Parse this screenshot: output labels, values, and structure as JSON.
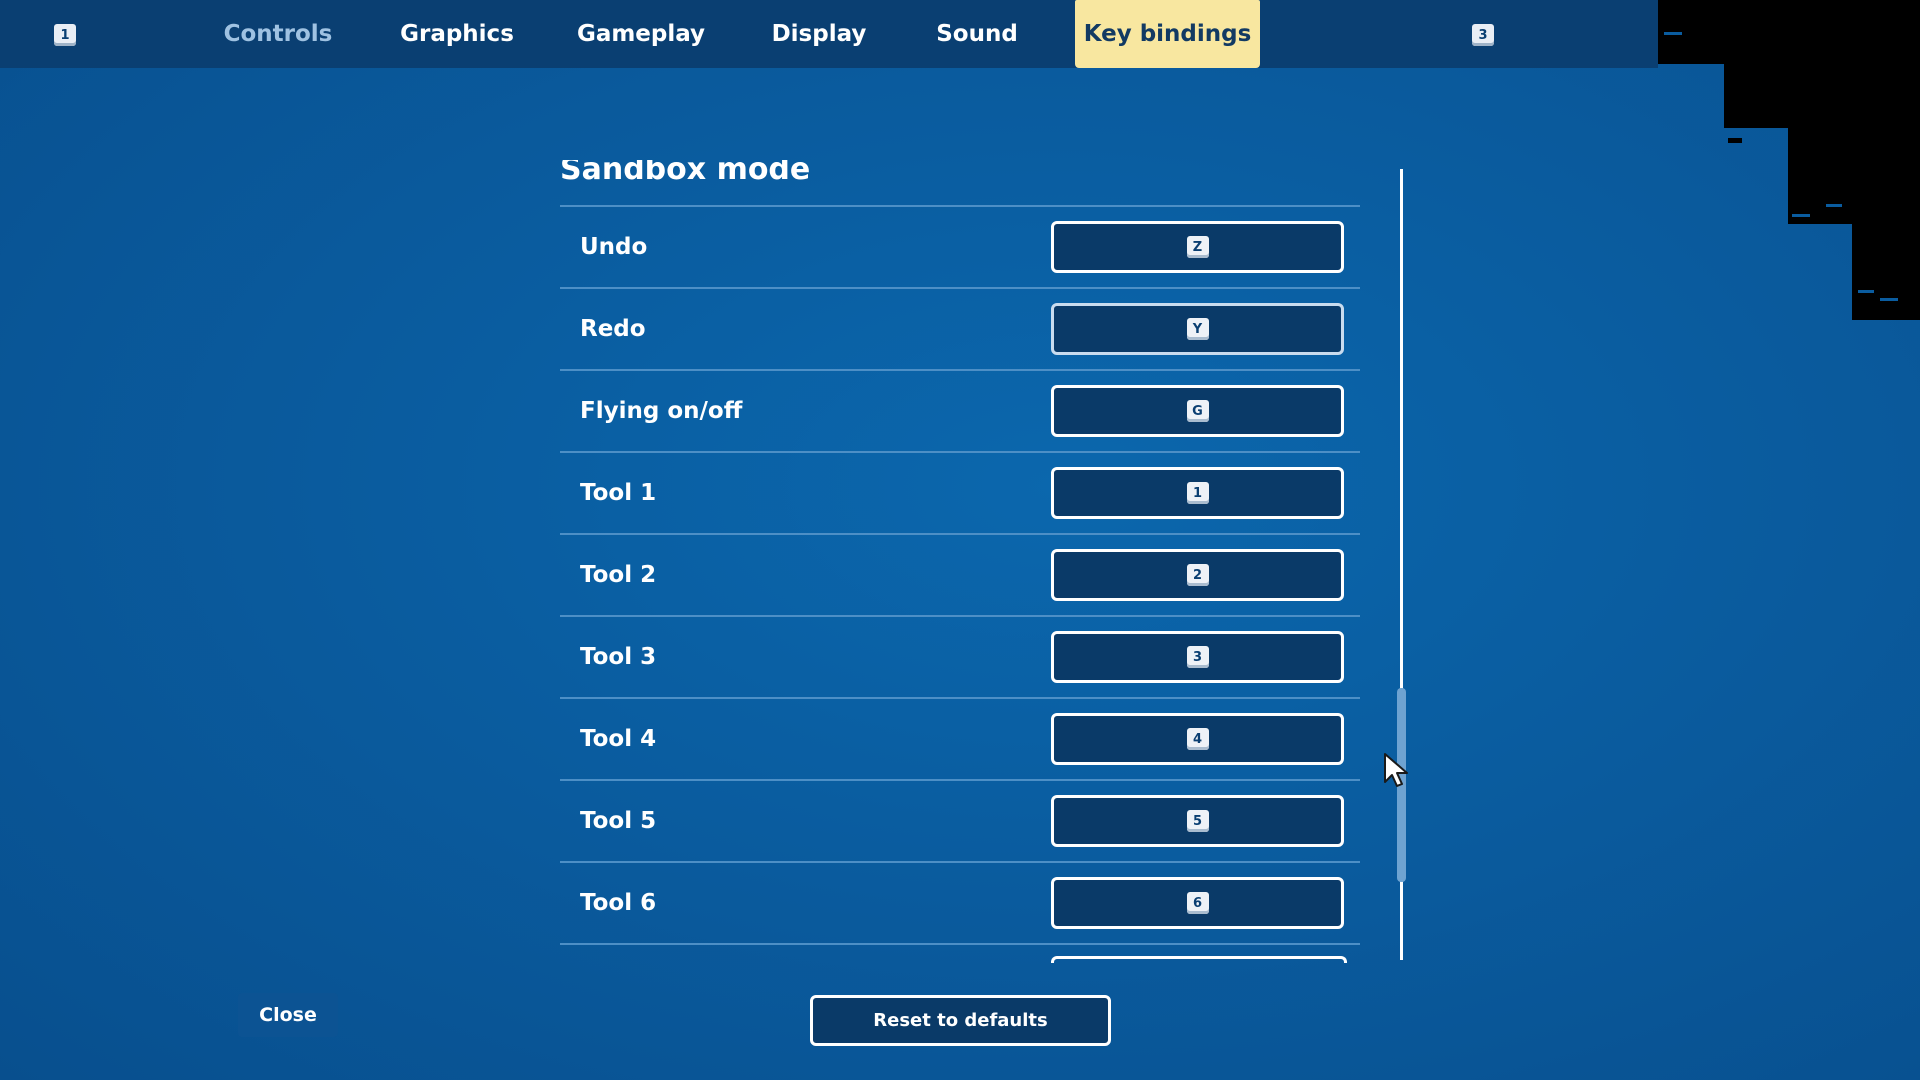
{
  "nav": {
    "left_hotkey": "1",
    "right_hotkey": "3",
    "tabs": [
      {
        "label": "Controls"
      },
      {
        "label": "Graphics"
      },
      {
        "label": "Gameplay"
      },
      {
        "label": "Display"
      },
      {
        "label": "Sound"
      },
      {
        "label": "Key bindings"
      }
    ],
    "active_tab": "Key bindings"
  },
  "section": {
    "heading": "Sandbox mode"
  },
  "bindings": [
    {
      "action": "Undo",
      "key": "Z"
    },
    {
      "action": "Redo",
      "key": "Y"
    },
    {
      "action": "Flying on/off",
      "key": "G"
    },
    {
      "action": "Tool 1",
      "key": "1"
    },
    {
      "action": "Tool 2",
      "key": "2"
    },
    {
      "action": "Tool 3",
      "key": "3"
    },
    {
      "action": "Tool 4",
      "key": "4"
    },
    {
      "action": "Tool 5",
      "key": "5"
    },
    {
      "action": "Tool 6",
      "key": "6"
    }
  ],
  "footer": {
    "close_label": "Close",
    "reset_label": "Reset to defaults"
  },
  "colors": {
    "background": "#0a5c9f",
    "topbar": "#0a3f72",
    "active_tab": "#f8e7a0",
    "button_fill": "#0a3a68"
  }
}
